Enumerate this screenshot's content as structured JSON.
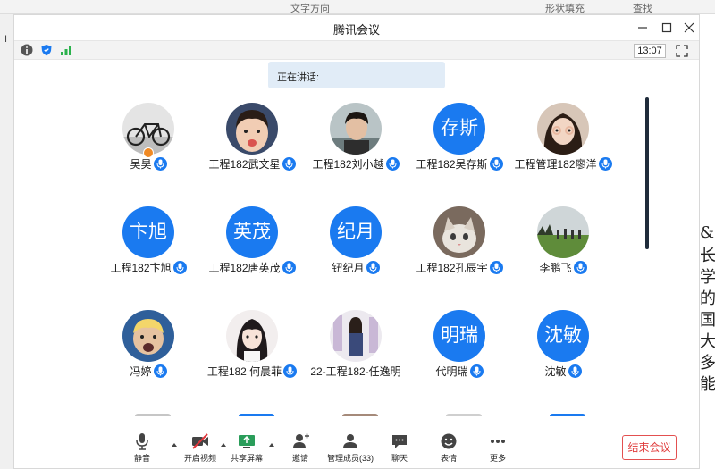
{
  "background_doc": {
    "toolbar_fragments": [
      "文字方向",
      "形状填充",
      "查找"
    ],
    "left_char": "I",
    "right_chars": [
      "&",
      "长",
      "学",
      "的",
      "国",
      "大",
      "多",
      "能"
    ]
  },
  "window": {
    "title": "腾讯会议",
    "clock": "13:07",
    "speaking_label": "正在讲话:"
  },
  "participants": [
    {
      "name": "吴昊",
      "avatar_text": "",
      "photo": "bicycle"
    },
    {
      "name": "工程182武文星",
      "avatar_text": "",
      "photo": "child"
    },
    {
      "name": "工程182刘小越",
      "avatar_text": "",
      "photo": "boy"
    },
    {
      "name": "工程182吴存斯",
      "avatar_text": "存斯",
      "photo": ""
    },
    {
      "name": "工程管理182廖洋",
      "avatar_text": "",
      "photo": "girl"
    },
    {
      "name": "工程182卞旭",
      "avatar_text": "卞旭",
      "photo": ""
    },
    {
      "name": "工程182唐英茂",
      "avatar_text": "英茂",
      "photo": ""
    },
    {
      "name": "钮纪月",
      "avatar_text": "纪月",
      "photo": ""
    },
    {
      "name": "工程182孔辰宇",
      "avatar_text": "",
      "photo": "cat"
    },
    {
      "name": "李鹏飞",
      "avatar_text": "",
      "photo": "field"
    },
    {
      "name": "冯婷",
      "avatar_text": "",
      "photo": "baby"
    },
    {
      "name": "工程182 何晨菲",
      "avatar_text": "",
      "photo": "anime"
    },
    {
      "name": "22-工程182-任逸明",
      "avatar_text": "",
      "photo": "person"
    },
    {
      "name": "代明瑞",
      "avatar_text": "明瑞",
      "photo": ""
    },
    {
      "name": "沈敏",
      "avatar_text": "沈敏",
      "photo": ""
    }
  ],
  "toolbar": {
    "mute": "静音",
    "video": "开启视频",
    "share": "共享屏幕",
    "invite": "邀请",
    "members": "管理成员(33)",
    "chat": "聊天",
    "emoji": "表情",
    "more": "更多",
    "end": "结束会议"
  },
  "colors": {
    "accent": "#1a7af0",
    "end_red": "#e03c3c",
    "video_off_red": "#e0353b"
  }
}
